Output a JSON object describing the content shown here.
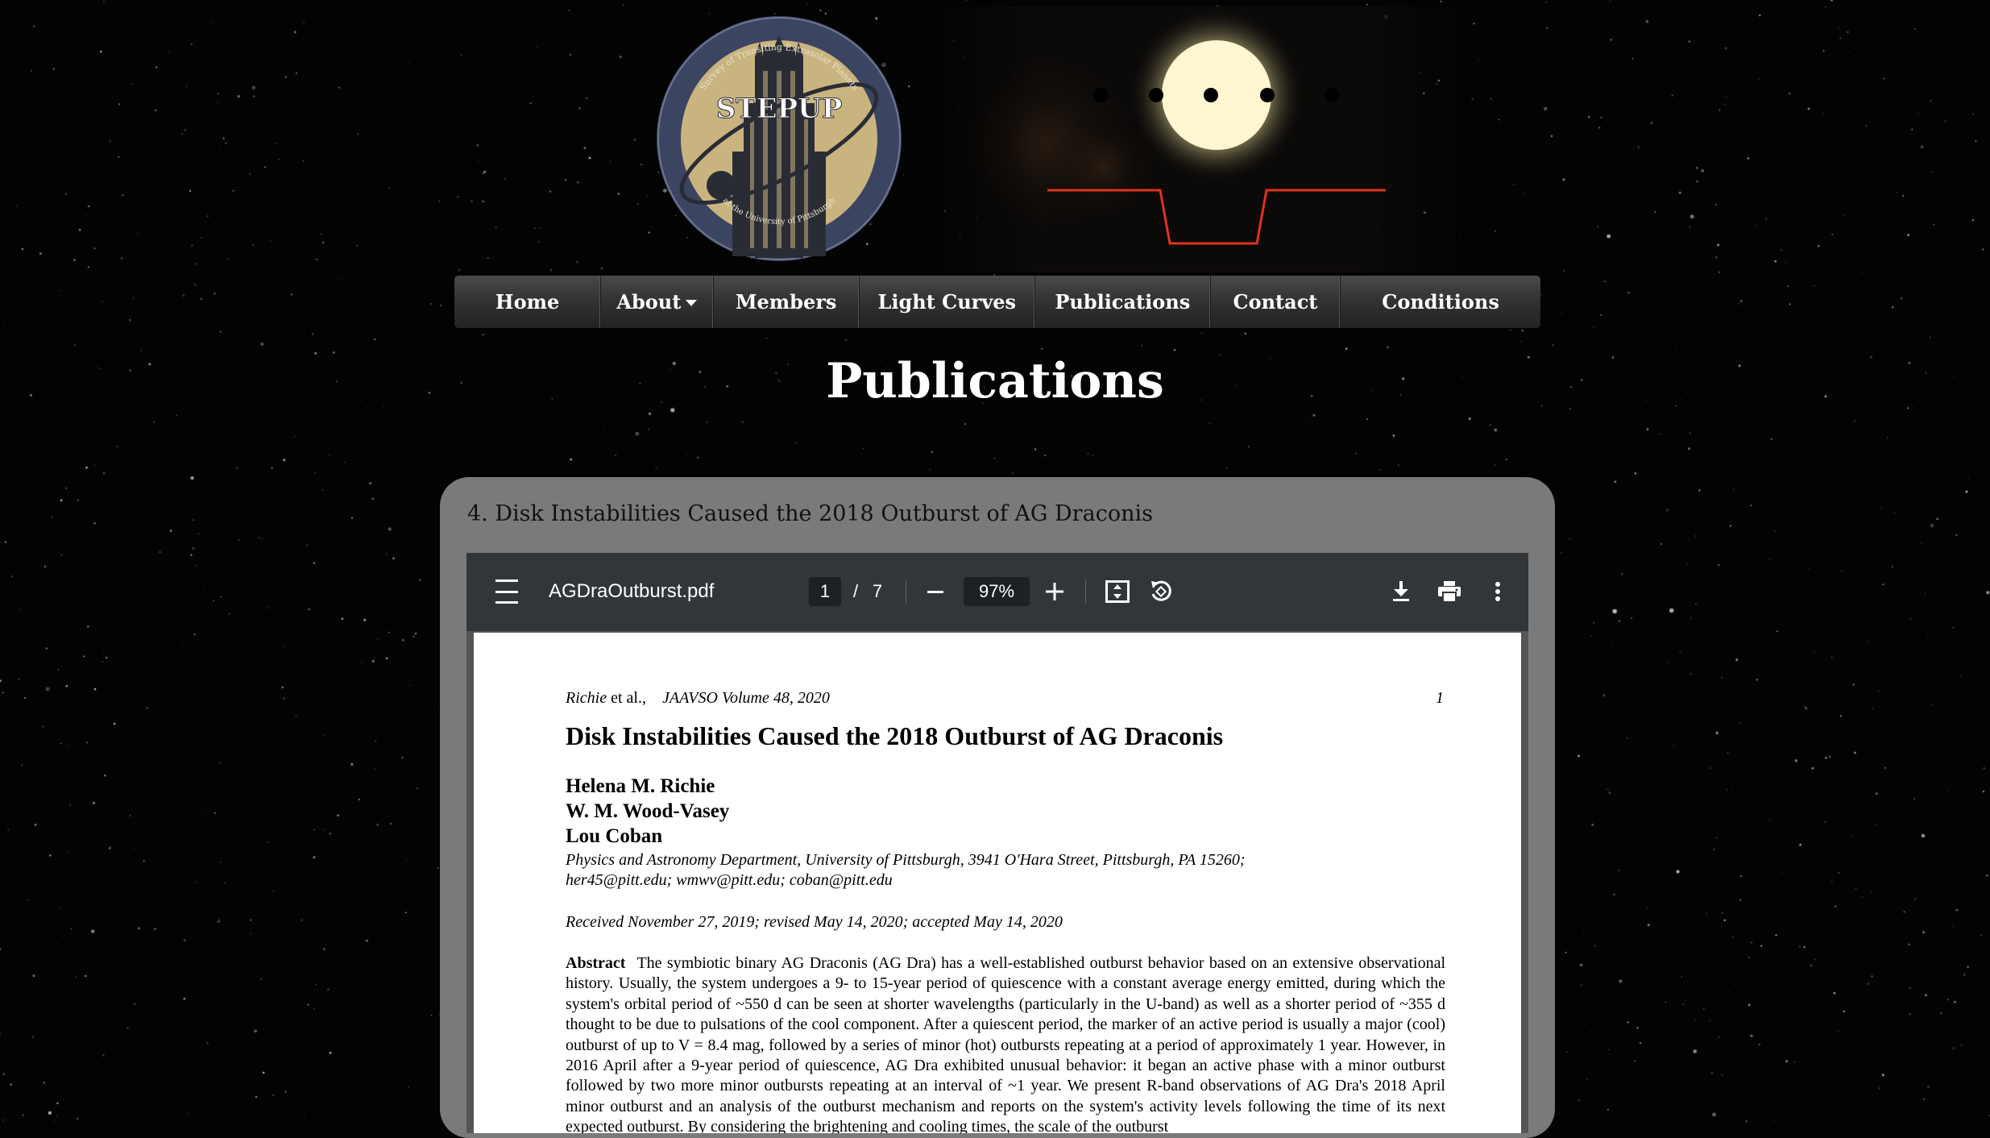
{
  "header": {
    "logo": {
      "title": "STEPUP",
      "arc_top": "Survey of Transiting Extrasolar Planets",
      "arc_bottom": "at the University of Pittsburgh"
    }
  },
  "nav": {
    "items": [
      {
        "label": "Home"
      },
      {
        "label": "About",
        "has_dropdown": true
      },
      {
        "label": "Members"
      },
      {
        "label": "Light Curves"
      },
      {
        "label": "Publications"
      },
      {
        "label": "Contact"
      },
      {
        "label": "Conditions"
      }
    ]
  },
  "page": {
    "title": "Publications"
  },
  "publication": {
    "heading": "4. Disk Instabilities Caused the 2018 Outburst of AG Draconis",
    "viewer": {
      "filename": "AGDraOutburst.pdf",
      "current_page": "1",
      "page_separator": "/",
      "total_pages": "7",
      "zoom": "97%",
      "icons": [
        "menu-icon",
        "zoom-out-icon",
        "zoom-in-icon",
        "fit-page-icon",
        "rotate-icon",
        "download-icon",
        "print-icon",
        "more-vertical-icon"
      ]
    },
    "document": {
      "running_author": "Richie",
      "running_etal": "et al.,",
      "running_journal": "JAAVSO Volume 48, 2020",
      "page_number": "1",
      "title": "Disk Instabilities Caused the 2018 Outburst of AG Draconis",
      "authors": [
        "Helena M. Richie",
        "W. M. Wood-Vasey",
        "Lou Coban"
      ],
      "affiliation_line1": "Physics and Astronomy Department, University of Pittsburgh, 3941 O'Hara Street, Pittsburgh, PA 15260;",
      "affiliation_line2": "her45@pitt.edu; wmwv@pitt.edu; coban@pitt.edu",
      "received": "Received November 27, 2019; revised May 14, 2020; accepted May 14, 2020",
      "abstract_label": "Abstract",
      "abstract_text": "The symbiotic binary AG Draconis (AG Dra) has a well-established outburst behavior based on an extensive observational history. Usually, the system undergoes a 9- to 15-year period of quiescence with a constant average energy emitted, during which the system's orbital period of ~550 d can be seen at shorter wavelengths (particularly in the U-band) as well as a shorter period of ~355 d thought to be due to pulsations of the cool component. After a quiescent period, the marker of an active period is usually a major (cool) outburst of up to V = 8.4 mag, followed by a series of minor (hot) outbursts repeating at a period of approximately 1 year. However, in 2016 April after a 9-year period of quiescence, AG Dra exhibited unusual behavior: it began an active phase with a minor outburst followed by two more minor outbursts repeating at an interval of ~1 year. We present R-band observations of AG Dra's 2018 April minor outburst and an analysis of the outburst mechanism and reports on the system's activity levels following the time of its next expected outburst. By considering the brightening and cooling times, the scale of the outburst"
    }
  },
  "colors": {
    "background": "#030303",
    "nav_bg": "#333333",
    "card_bg": "#7a7a7a",
    "toolbar_bg": "#323639",
    "logo_gold": "#c9b47f",
    "logo_navy": "#3b4461",
    "transit_curve": "#e0321e"
  }
}
